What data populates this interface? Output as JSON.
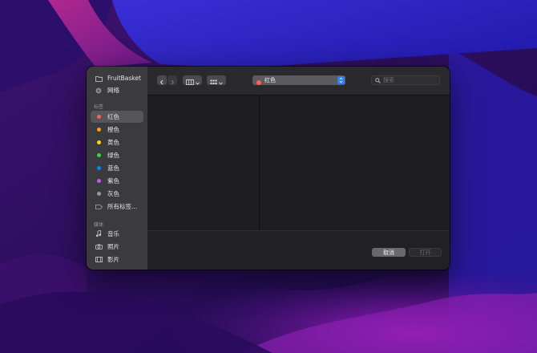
{
  "sidebar": {
    "items": [
      {
        "label": "FruitBasket",
        "icon": "folder-icon"
      },
      {
        "label": "网络",
        "icon": "network-globe-icon"
      }
    ],
    "tags_heading": "标签",
    "tags": [
      {
        "label": "红色",
        "color": "#ff5f57",
        "selected": true
      },
      {
        "label": "橙色",
        "color": "#ff9f0a"
      },
      {
        "label": "黄色",
        "color": "#ffd60a"
      },
      {
        "label": "绿色",
        "color": "#32d74b"
      },
      {
        "label": "蓝色",
        "color": "#0a84ff"
      },
      {
        "label": "紫色",
        "color": "#bf5af2"
      },
      {
        "label": "灰色",
        "color": "#98989d"
      },
      {
        "label": "所有标签...",
        "icon": "all-tags-icon"
      }
    ],
    "media_heading": "媒体",
    "media": [
      {
        "label": "音乐",
        "icon": "music-note-icon"
      },
      {
        "label": "照片",
        "icon": "camera-icon"
      },
      {
        "label": "影片",
        "icon": "film-icon"
      }
    ]
  },
  "toolbar": {
    "location": {
      "label": "红色",
      "color": "#ff5f57"
    },
    "search_placeholder": "搜索"
  },
  "buttons": {
    "cancel": "取消",
    "open": "打开"
  },
  "colors": {
    "accent": "#2f7cf6"
  }
}
